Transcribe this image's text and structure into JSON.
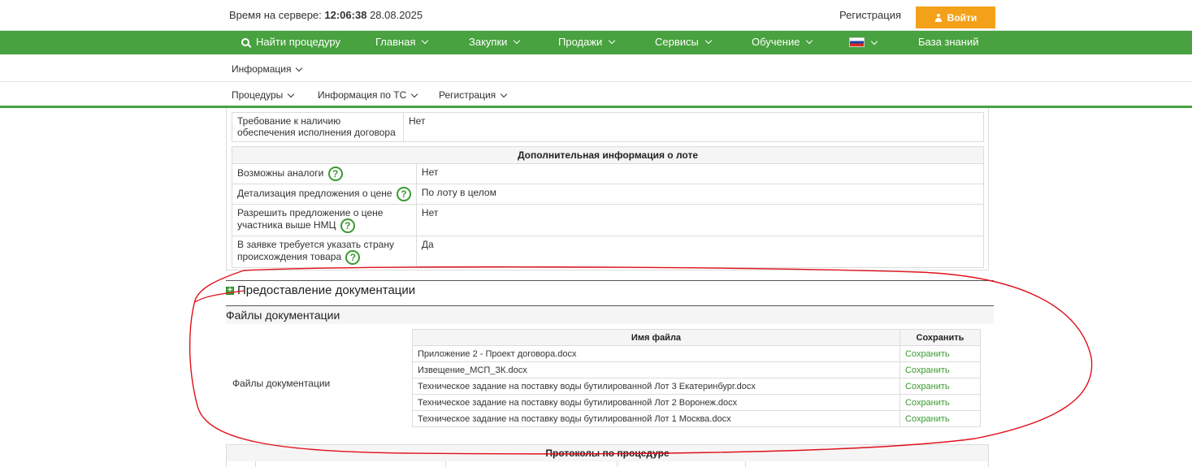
{
  "topbar": {
    "server_time_label": "Время на сервере:",
    "server_time": "12:06:38",
    "server_date": "28.08.2025",
    "register": "Регистрация",
    "login": "Войти"
  },
  "nav": {
    "search": "Найти процедуру",
    "main": "Главная",
    "purchases": "Закупки",
    "sales": "Продажи",
    "services": "Сервисы",
    "training": "Обучение",
    "knowledge": "База знаний"
  },
  "subnav1": {
    "info": "Информация"
  },
  "subnav2": {
    "procedures": "Процедуры",
    "ts_info": "Информация по ТС",
    "registration": "Регистрация"
  },
  "contract": {
    "label": "Требование к наличию обеспечения исполнения договора",
    "value": "Нет"
  },
  "extra": {
    "header": "Дополнительная информация о лоте",
    "rows": [
      {
        "label": "Возможны аналоги",
        "value": "Нет"
      },
      {
        "label": "Детализация предложения о цене",
        "value": "По лоту в целом"
      },
      {
        "label": "Разрешить предложение о цене участника выше НМЦ",
        "value": "Нет"
      },
      {
        "label": "В заявке требуется указать страну происхождения товара",
        "value": "Да"
      }
    ]
  },
  "docs_section": "Предоставление документации",
  "files": {
    "header": "Файлы документации",
    "label": "Файлы документации",
    "col_name": "Имя файла",
    "col_save": "Сохранить",
    "rows": [
      {
        "name": "Приложение 2 - Проект договора.docx",
        "save": "Сохранить"
      },
      {
        "name": "Извещение_МСП_ЗК.docx",
        "save": "Сохранить"
      },
      {
        "name": "Техническое задание на поставку воды бутилированной Лот 3 Екатеринбург.docx",
        "save": "Сохранить"
      },
      {
        "name": "Техническое задание на поставку воды бутилированной Лот 2 Воронеж.docx",
        "save": "Сохранить"
      },
      {
        "name": "Техническое задание на поставку воды бутилированной Лот 1 Москва.docx",
        "save": "Сохранить"
      }
    ]
  },
  "protocols": {
    "title": "Протоколы по процедуре"
  },
  "colors": {
    "green": "#48a23f",
    "orange": "#f4a11a",
    "annotation": "#e0101a"
  }
}
